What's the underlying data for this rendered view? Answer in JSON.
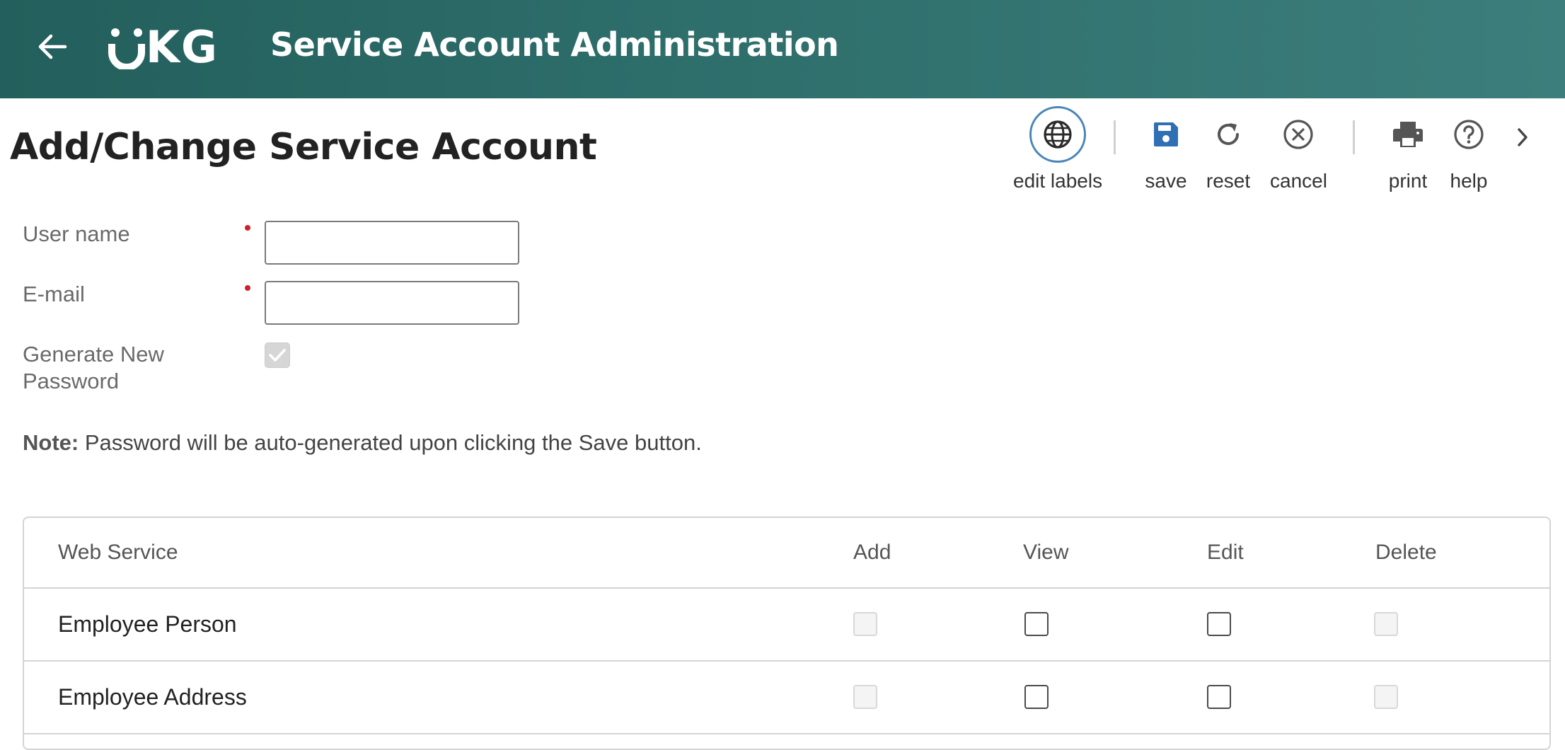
{
  "header": {
    "app_title": "Service Account Administration",
    "logo_text": "UKG",
    "logo_rest": "KG",
    "back_icon": "arrow-left-icon",
    "background_colors": [
      "#235f5c",
      "#3c7e7b"
    ]
  },
  "page": {
    "title": "Add/Change Service Account"
  },
  "toolbar": {
    "edit_labels": {
      "label": "edit labels",
      "icon": "globe-icon"
    },
    "save": {
      "label": "save",
      "icon": "floppy-disk-icon",
      "color": "#2f6fb4"
    },
    "reset": {
      "label": "reset",
      "icon": "refresh-icon"
    },
    "cancel": {
      "label": "cancel",
      "icon": "circle-x-icon"
    },
    "print": {
      "label": "print",
      "icon": "printer-icon"
    },
    "help": {
      "label": "help",
      "icon": "question-circle-icon"
    },
    "more": {
      "icon": "chevron-right-icon"
    }
  },
  "form": {
    "user_name": {
      "label": "User name",
      "value": "",
      "required": true
    },
    "email": {
      "label": "E-mail",
      "value": "",
      "required": true
    },
    "generate_password": {
      "label_line1": "Generate New",
      "label_line2": "Password",
      "checked": true,
      "disabled": true
    },
    "note_prefix": "Note:",
    "note_text": " Password will be auto-generated upon clicking the Save button."
  },
  "table": {
    "columns": [
      "Web Service",
      "Add",
      "View",
      "Edit",
      "Delete"
    ],
    "rows": [
      {
        "name": "Employee Person",
        "add": {
          "checked": false,
          "disabled": true
        },
        "view": {
          "checked": false,
          "disabled": false
        },
        "edit": {
          "checked": false,
          "disabled": false
        },
        "delete": {
          "checked": false,
          "disabled": true
        }
      },
      {
        "name": "Employee Address",
        "add": {
          "checked": false,
          "disabled": true
        },
        "view": {
          "checked": false,
          "disabled": false
        },
        "edit": {
          "checked": false,
          "disabled": false
        },
        "delete": {
          "checked": false,
          "disabled": true
        }
      }
    ]
  },
  "colors": {
    "required_marker": "#d0202a",
    "focus_ring": "#4a86b8"
  }
}
